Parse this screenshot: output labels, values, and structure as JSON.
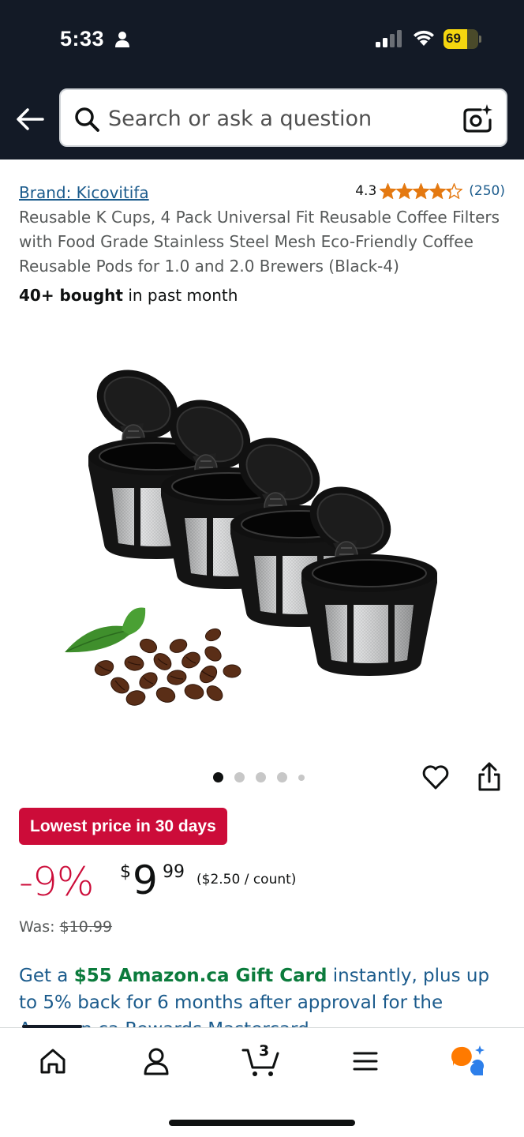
{
  "status_bar": {
    "time": "5:33",
    "battery": "69",
    "battery_level": 0.69,
    "icons": [
      "person-icon",
      "signal-icon",
      "wifi-icon",
      "battery-icon"
    ]
  },
  "header": {
    "search_placeholder": "Search or ask a question",
    "icons": [
      "back-arrow-icon",
      "search-icon",
      "camera-search-icon"
    ]
  },
  "product": {
    "brand": "Brand: Kicovitifa",
    "rating": "4.3",
    "rating_stars": 4.3,
    "review_count": "(250)",
    "title": "Reusable K Cups, 4 Pack Universal Fit Reusable Coffee Filters with Food Grade Stainless Steel Mesh Eco-Friendly Coffee Reusable Pods for 1.0 and 2.0 Brewers (Black-4)",
    "bought_bold": "40+ bought",
    "bought_rest": " in past month",
    "image_count": 5,
    "active_image": 1
  },
  "pricing": {
    "deal_badge": "Lowest price in 30 days",
    "discount": "-9%",
    "currency": "$",
    "price_whole": "9",
    "price_fraction": "99",
    "unit_price": "($2.50 / count)",
    "was_label": "Was: ",
    "was_price": "$10.99"
  },
  "promo": {
    "lead": "Get a ",
    "highlight": "$55 Amazon.ca Gift Card",
    "rest": " instantly, plus up to 5% back for 6 months after approval for the Amazon.ca Rewards Mastercard"
  },
  "tabbar": {
    "cart_count": "3",
    "tabs": [
      "home-icon",
      "account-icon",
      "cart-icon",
      "menu-icon",
      "rufus-assistant-icon"
    ]
  },
  "colors": {
    "header_bg": "#131a26",
    "link": "#1b5b8c",
    "deal_red": "#cc0c39",
    "star_orange": "#e47911",
    "promo_green": "#0b7b3c"
  }
}
